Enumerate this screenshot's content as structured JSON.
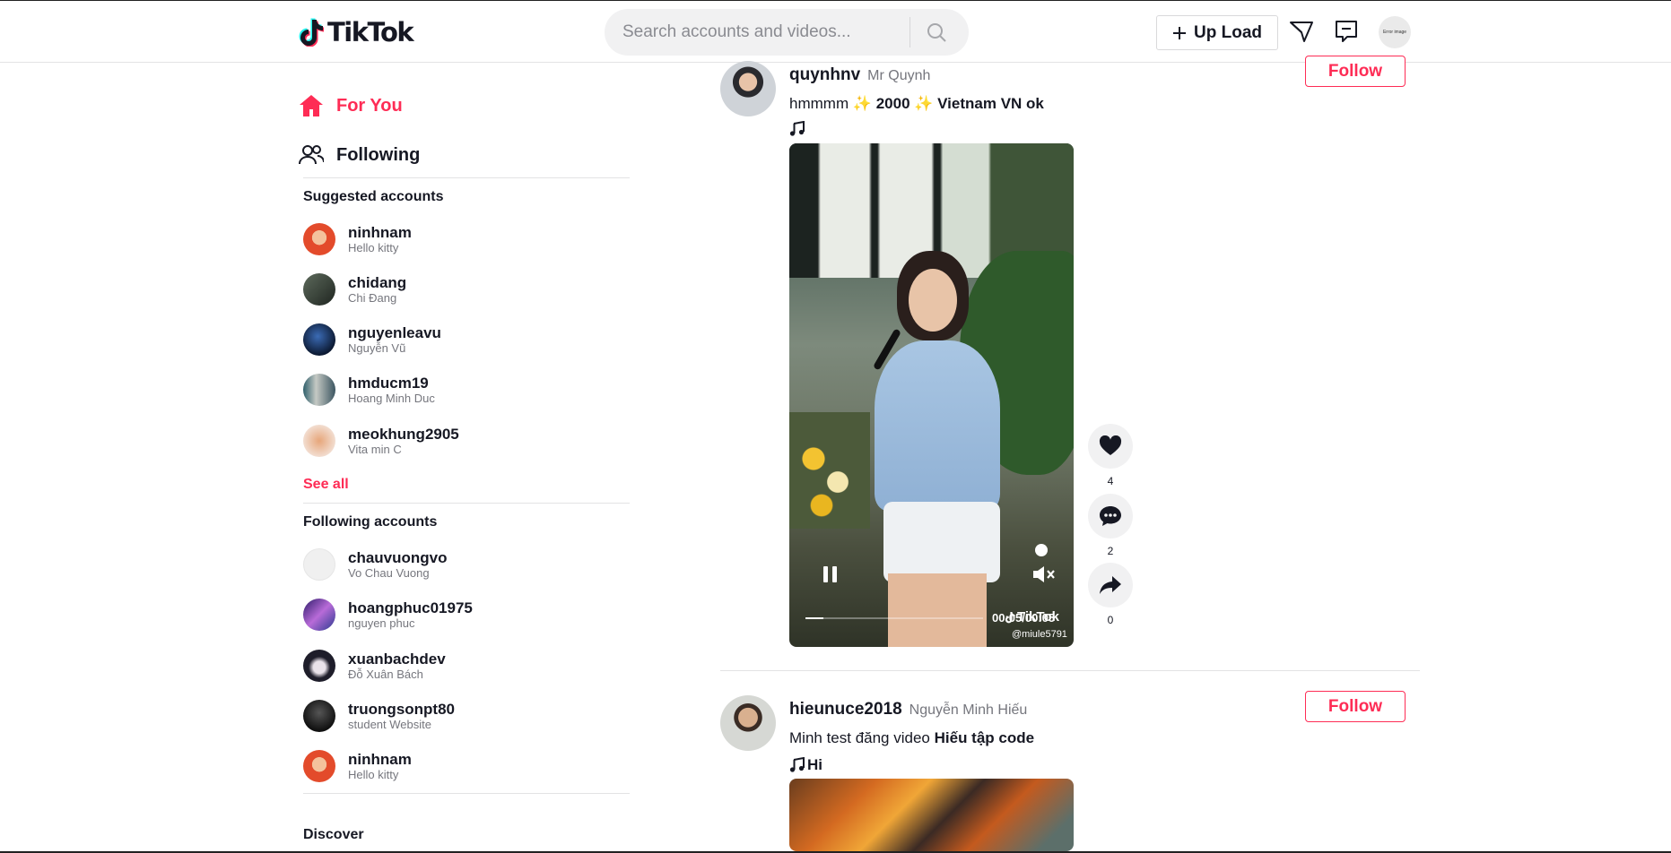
{
  "header": {
    "logo_text": "TikTok",
    "search_placeholder": "Search accounts and videos...",
    "upload_label": "Up Load",
    "avatar_text": "Error image"
  },
  "sidebar": {
    "nav": [
      {
        "label": "For You",
        "icon": "home-icon",
        "active": true
      },
      {
        "label": "Following",
        "icon": "users-icon",
        "active": false
      }
    ],
    "suggested_title": "Suggested accounts",
    "suggested": [
      {
        "username": "ninhnam",
        "name": "Hello kitty"
      },
      {
        "username": "chidang",
        "name": "Chi Đang"
      },
      {
        "username": "nguyenleavu",
        "name": "Nguyễn Vũ"
      },
      {
        "username": "hmducm19",
        "name": "Hoang Minh Duc"
      },
      {
        "username": "meokhung2905",
        "name": "Vita min C"
      }
    ],
    "see_all": "See all",
    "following_title": "Following accounts",
    "following": [
      {
        "username": "chauvuongvo",
        "name": "Vo Chau Vuong"
      },
      {
        "username": "hoangphuc01975",
        "name": "nguyen phuc"
      },
      {
        "username": "xuanbachdev",
        "name": "Đỗ Xuân Bách"
      },
      {
        "username": "truongsonpt80",
        "name": "student Website"
      },
      {
        "username": "ninhnam",
        "name": "Hello kitty"
      }
    ],
    "discover_title": "Discover"
  },
  "posts": [
    {
      "username": "quynhnv",
      "nickname": "Mr Quynh",
      "caption_plain": "hmmmm ",
      "caption_bold": "✨ 2000 ✨ Vietnam VN ok",
      "music": "",
      "follow_label": "Follow",
      "likes": "4",
      "comments": "2",
      "shares": "0",
      "video": {
        "time": "00:05/00:05",
        "watermark": "TikTok",
        "handle": "@miule5791",
        "progress": 0.1
      }
    },
    {
      "username": "hieunuce2018",
      "nickname": "Nguyễn Minh Hiếu",
      "caption_plain": "Minh test đăng video ",
      "caption_bold": "Hiếu tập code",
      "music": "Hi",
      "follow_label": "Follow"
    }
  ]
}
